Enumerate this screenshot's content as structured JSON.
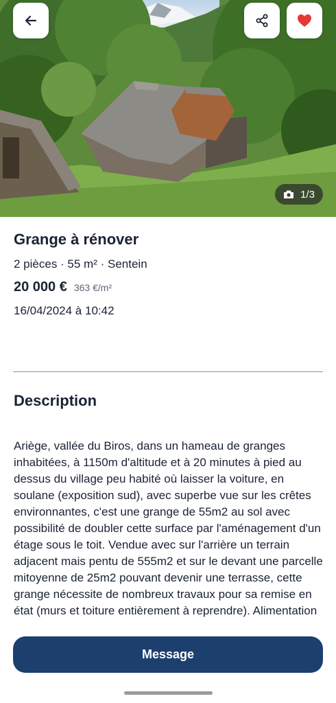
{
  "gallery": {
    "counter": "1/3",
    "back_icon": "arrow-left-icon",
    "share_icon": "share-icon",
    "favorite_icon": "heart-icon",
    "favorite_color": "#e53935"
  },
  "listing": {
    "title": "Grange à rénover",
    "subtitle": "2 pièces · 55 m² · Sentein",
    "price": "20 000 €",
    "price_per_m2": "363 €/m²",
    "date": "16/04/2024 à 10:42"
  },
  "description": {
    "heading": "Description",
    "text": "Ariège, vallée du Biros, dans un hameau de granges inhabitées, à 1150m d'altitude et à 20 minutes à pied au dessus du village peu habité où laisser la voiture, en soulane (exposition sud), avec superbe vue sur les crêtes environnantes, c'est une grange de 55m2 au sol avec possibilité de doubler cette surface par l'aménagement d'un étage sous le toit. Vendue avec sur l'arrière un terrain adjacent  mais pentu de 555m2 et sur le devant une parcelle mitoyenne de 25m2 pouvant devenir une terrasse, cette grange nécessite de nombreux travaux pour sa remise en état (murs et toiture entièrement à reprendre). Alimentation"
  },
  "actions": {
    "message_label": "Message",
    "primary_color": "#1c3f6e"
  }
}
